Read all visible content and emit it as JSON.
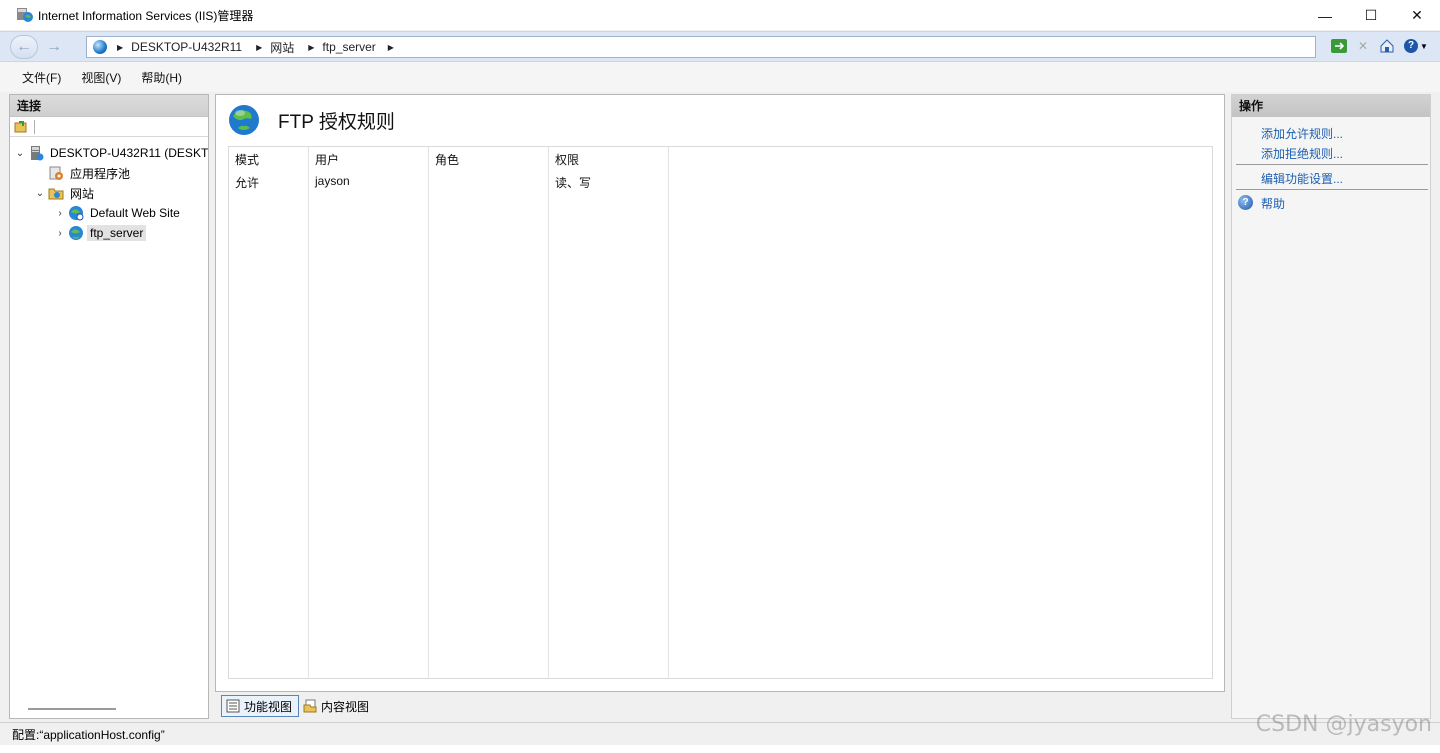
{
  "window": {
    "title": "Internet Information Services (IIS)管理器",
    "controls": {
      "minimize": "—",
      "maximize": "☐",
      "close": "✕"
    }
  },
  "nav": {
    "breadcrumbs": [
      "DESKTOP-U432R11",
      "网站",
      "ftp_server"
    ]
  },
  "menu": [
    "文件(F)",
    "视图(V)",
    "帮助(H)"
  ],
  "connections": {
    "title": "连接",
    "tree": [
      {
        "label": "DESKTOP-U432R11 (DESKT",
        "toggle": "⌄",
        "icon": "server-icon"
      },
      {
        "label": "应用程序池",
        "toggle": "",
        "icon": "app-pool-icon"
      },
      {
        "label": "网站",
        "toggle": "⌄",
        "icon": "sites-folder-icon"
      },
      {
        "label": "Default Web Site",
        "toggle": "›",
        "icon": "website-icon"
      },
      {
        "label": "ftp_server",
        "toggle": "›",
        "icon": "globe-icon",
        "selected": true
      }
    ]
  },
  "main": {
    "title": "FTP 授权规则",
    "columns": [
      "模式",
      "用户",
      "角色",
      "权限"
    ],
    "rows": [
      {
        "mode": "允许",
        "user": "jayson",
        "role": "",
        "permission": "读、写"
      }
    ]
  },
  "tabs": {
    "feature_view": "功能视图",
    "content_view": "内容视图"
  },
  "actions": {
    "title": "操作",
    "add_allow": "添加允许规则...",
    "add_deny": "添加拒绝规则...",
    "edit_settings": "编辑功能设置...",
    "help": "帮助"
  },
  "status": {
    "text": "配置:“applicationHost.config”"
  },
  "watermark": "CSDN @jyasyon",
  "colors": {
    "link": "#1c5fb0",
    "nav_bg": "#dce6f4"
  }
}
